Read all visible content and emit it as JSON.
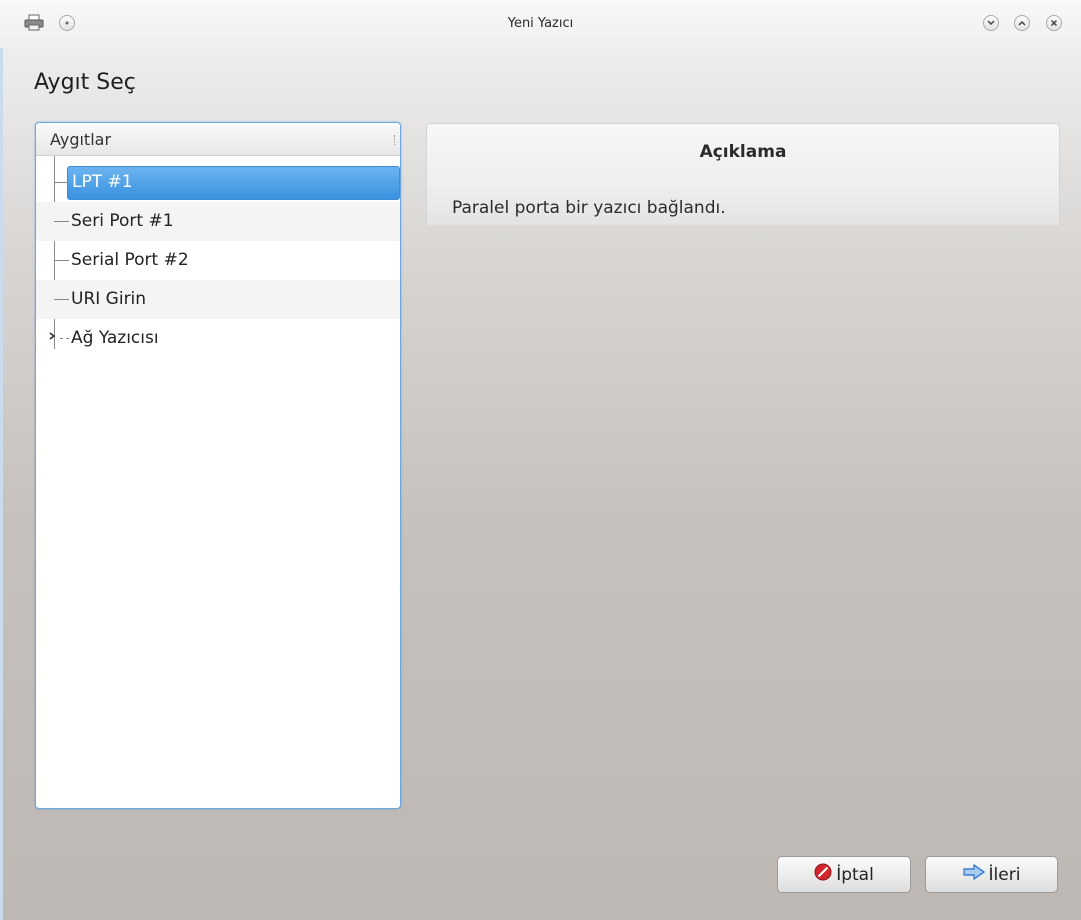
{
  "window": {
    "title": "Yeni Yazıcı",
    "icons": [
      "printer-icon",
      "pin-icon",
      "minimize-icon",
      "maximize-icon",
      "close-icon"
    ]
  },
  "page": {
    "title": "Aygıt Seç"
  },
  "devices": {
    "header": "Aygıtlar",
    "items": [
      {
        "label": "LPT #1",
        "selected": true
      },
      {
        "label": "Seri Port #1",
        "selected": false
      },
      {
        "label": "Serial Port #2",
        "selected": false
      },
      {
        "label": "URI Girin",
        "selected": false
      },
      {
        "label": "Ağ Yazıcısı",
        "selected": false,
        "expandable": true
      }
    ]
  },
  "description": {
    "title": "Açıklama",
    "text": "Paralel porta bir yazıcı bağlandı."
  },
  "buttons": {
    "cancel": "İptal",
    "next": "İleri"
  },
  "colors": {
    "selection": "#3a92df",
    "focus_border": "#69a7dc",
    "cancel_icon": "#d2262c",
    "next_icon": "#3b7fd0"
  }
}
